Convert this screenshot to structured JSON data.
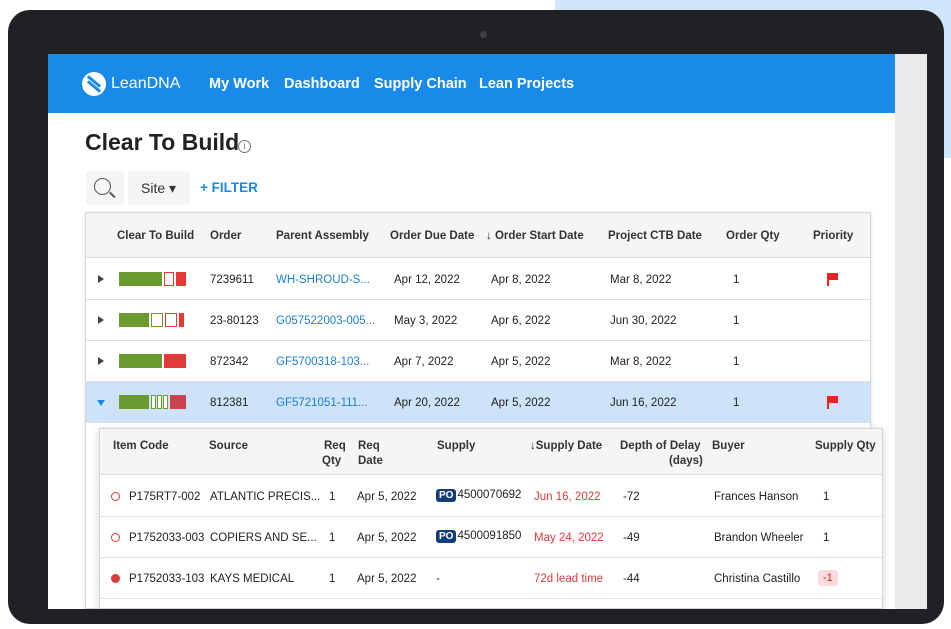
{
  "app": {
    "brand": "LeanDNA",
    "nav": [
      "My Work",
      "Dashboard",
      "Supply Chain",
      "Lean Projects"
    ]
  },
  "page": {
    "title": "Clear To Build",
    "info_glyph": "i"
  },
  "toolbar": {
    "site_label": "Site ▾",
    "filter_label": "+ FILTER"
  },
  "grid": {
    "headers": [
      "Clear To Build",
      "Order",
      "Parent Assembly",
      "Order Due Date",
      "↓ Order Start Date",
      "Project CTB Date",
      "Order Qty",
      "Priority"
    ],
    "rows": [
      {
        "order": "7239611",
        "parent": "WH-SHROUD-S...",
        "due": "Apr 12, 2022",
        "start": "Apr 8, 2022",
        "ctb": "Mar 8, 2022",
        "qty": "1",
        "priority_flag": true,
        "expanded": false
      },
      {
        "order": "23-80123",
        "parent": "G057522003-005...",
        "due": "May 3, 2022",
        "start": "Apr 6, 2022",
        "ctb": "Jun 30, 2022",
        "qty": "1",
        "priority_flag": false,
        "expanded": false
      },
      {
        "order": "872342",
        "parent": "GF5700318-103...",
        "due": "Apr 7, 2022",
        "start": "Apr 5, 2022",
        "ctb": "Mar 8, 2022",
        "qty": "1",
        "priority_flag": false,
        "expanded": false
      },
      {
        "order": "812381",
        "parent": "GF5721051-111...",
        "due": "Apr 20, 2022",
        "start": "Apr 5, 2022",
        "ctb": "Jun 16, 2022",
        "qty": "1",
        "priority_flag": true,
        "expanded": true
      }
    ]
  },
  "subgrid": {
    "headers": {
      "item_code": "Item Code",
      "source": "Source",
      "req_qty_1": "Req",
      "req_qty_2": "Qty",
      "req_date_1": "Req",
      "req_date_2": "Date",
      "supply": "Supply",
      "supply_date": "↓Supply Date",
      "delay_1": "Depth of Delay",
      "delay_2": "(days)",
      "buyer": "Buyer",
      "supply_qty": "Supply Qty"
    },
    "rows": [
      {
        "item": "P175RT7-002",
        "source": "ATLANTIC PRECIS...",
        "req_qty": "1",
        "req_date": "Apr 5, 2022",
        "po_badge": "PO",
        "supply": "4500070692",
        "supply_date": "Jun 16, 2022",
        "delay": "-72",
        "buyer": "Frances Hanson",
        "supply_qty": "1"
      },
      {
        "item": "P1752033-003",
        "source": "COPIERS AND SE...",
        "req_qty": "1",
        "req_date": "Apr 5, 2022",
        "po_badge": "PO",
        "supply": "4500091850",
        "supply_date": "May 24, 2022",
        "delay": "-49",
        "buyer": "Brandon Wheeler",
        "supply_qty": "1"
      },
      {
        "item": "P1752033-103",
        "source": "KAYS MEDICAL",
        "req_qty": "1",
        "req_date": "Apr 5, 2022",
        "po_badge": "",
        "supply": "-",
        "supply_date": "72d lead time",
        "delay": "-44",
        "buyer": "Christina Castillo",
        "supply_qty": "-1"
      }
    ]
  },
  "colors": {
    "topbar": "#1a8ae8",
    "link": "#1a7fd6",
    "ctb_green": "#6b9a2f",
    "ctb_red": "#e53935",
    "alert_red": "#e03a3a",
    "selected_row": "#cce3f9",
    "po_badge": "#123e78"
  }
}
